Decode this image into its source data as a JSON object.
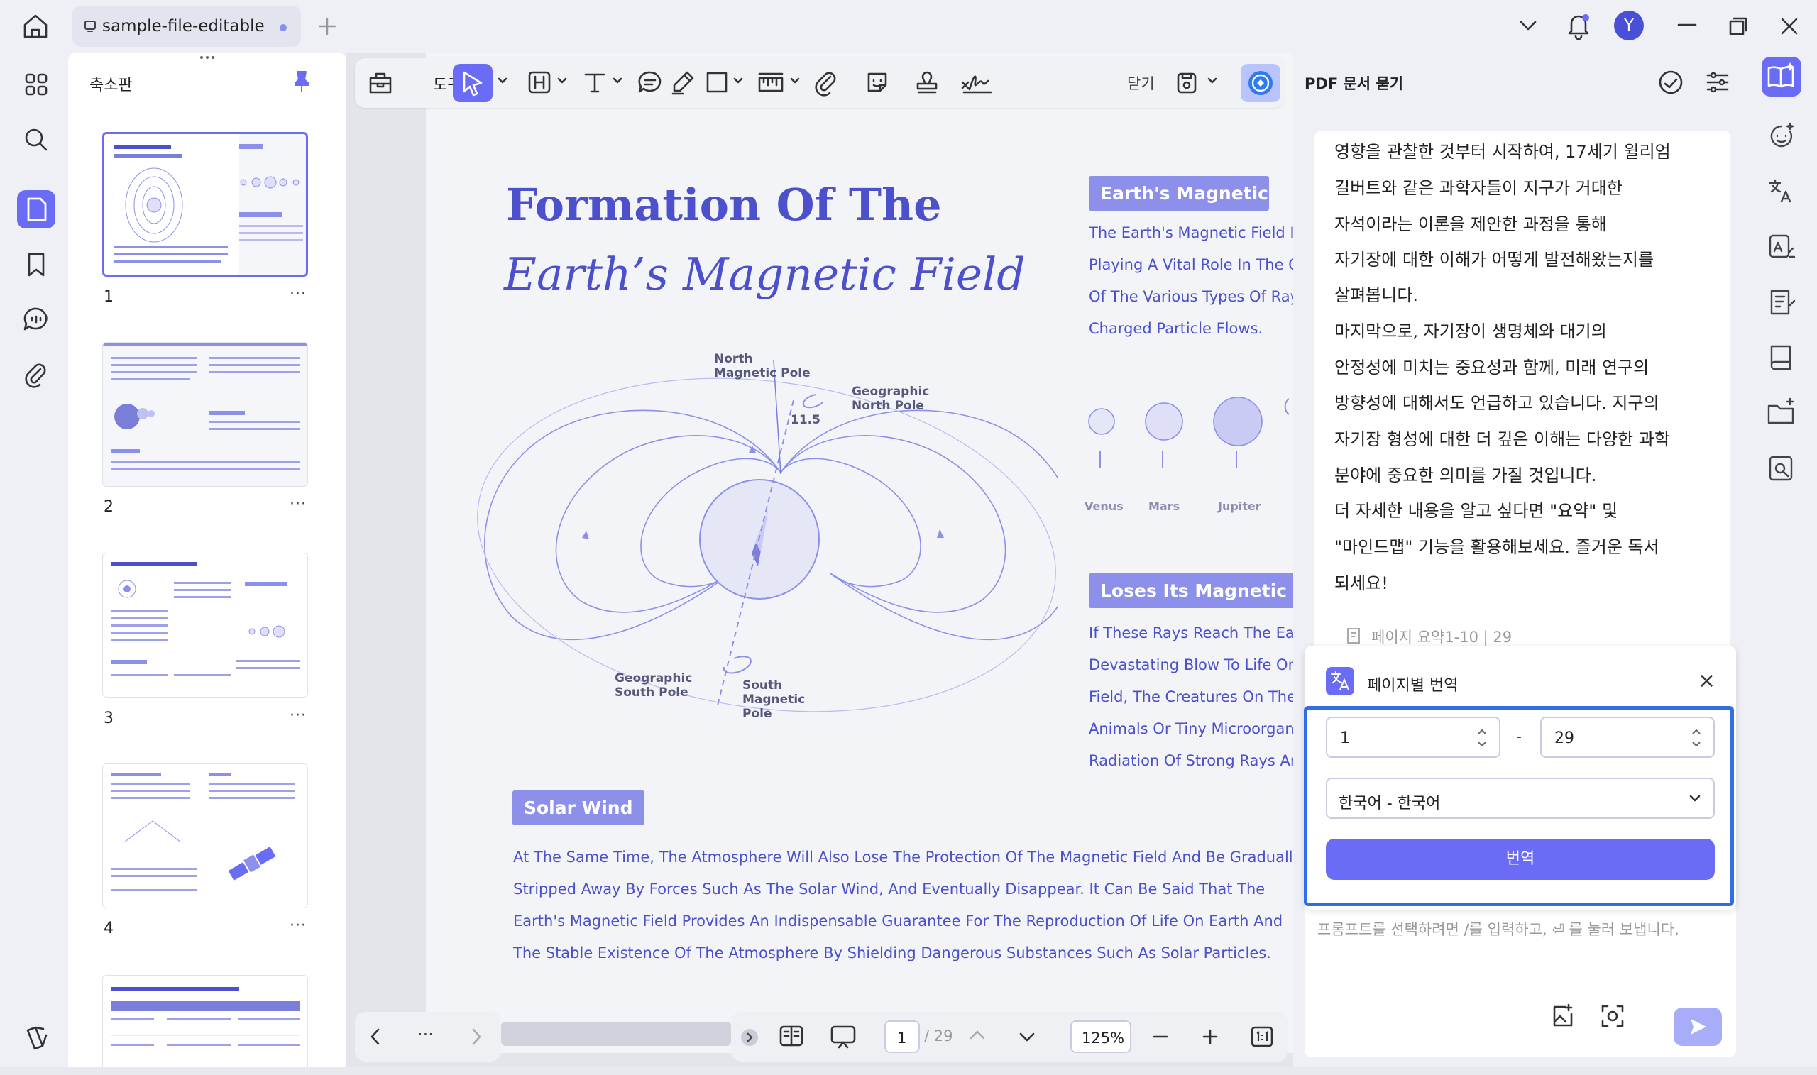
{
  "window": {
    "tab_title": "sample-file-editable",
    "avatar_letter": "Y"
  },
  "sidebar": {
    "title": "축소판",
    "pages": [
      "1",
      "2",
      "3",
      "4"
    ],
    "more": "···"
  },
  "toolbar": {
    "tools_label": "도구",
    "close_label": "닫기"
  },
  "document": {
    "title_line1": "Formation Of The",
    "title_line2": "Earth’s Magnetic Field",
    "earth_tag": "Earth's Magnetic",
    "earth_lines": [
      "The Earth's Magnetic Field Is L",
      "Playing A Vital Role In The Cos",
      "Of The Various Types Of Rays",
      "Charged Particle Flows."
    ],
    "planets": [
      "Venus",
      "Mars",
      "Jupiter"
    ],
    "diagram": {
      "north_magnetic_pole": [
        "North",
        "Magnetic Pole"
      ],
      "geographic_north_pole": [
        "Geographic",
        "North Pole"
      ],
      "angle": "11.5",
      "geographic_south_pole": [
        "Geographic",
        "South Pole"
      ],
      "south_magnetic_pole": [
        "South",
        "Magnetic",
        "Pole"
      ]
    },
    "loses_tag": "Loses Its Magnetic Field",
    "loses_lines": [
      "If These Rays Reach The Earth",
      "Devastating Blow To Life On Ea",
      "Field, The Creatures On The Ea",
      "Animals Or Tiny Microorganism",
      "Radiation Of Strong Rays And"
    ],
    "solar_tag": "Solar Wind",
    "solar_lines": [
      "At The Same Time, The Atmosphere Will Also Lose The Protection Of The Magnetic Field And Be Gradually",
      "Stripped Away By Forces Such As The Solar Wind, And Eventually Disappear. It Can Be Said That The",
      "Earth's Magnetic Field Provides An Indispensable Guarantee For The Reproduction Of Life On Earth And",
      "The Stable Existence Of The Atmosphere By Shielding Dangerous Substances Such As Solar Particles."
    ]
  },
  "chat": {
    "title": "PDF 문서 묻기",
    "lines": [
      "영향을 관찰한 것부터 시작하여, 17세기 윌리엄",
      "길버트와 같은 과학자들이 지구가 거대한",
      "자석이라는 이론을 제안한 과정을 통해",
      "자기장에 대한 이해가 어떻게 발전해왔는지를",
      "살펴봅니다.",
      "마지막으로, 자기장이 생명체와 대기의",
      "안정성에 미치는 중요성과 함께, 미래 연구의",
      "방향성에 대해서도 언급하고 있습니다. 지구의",
      "자기장 형성에 대한 더 깊은 이해는 다양한 과학",
      "분야에 중요한 의미를 가질 것입니다.",
      "더 자세한 내용을 알고 싶다면 \"요약\" 및",
      "\"마인드맵\" 기능을 활용해보세요. 즐거운 독서",
      "되세요!"
    ],
    "summary_link": "페이지 요약1-10 | 29",
    "prompt_placeholder": "프롬프트를 선택하려면 /를 입력하고, ⏎ 를 눌러 보냅니다."
  },
  "translate_popup": {
    "title": "페이지별 번역",
    "from_page": "1",
    "dash": "-",
    "to_page": "29",
    "language": "한국어 - 한국어",
    "button": "번역"
  },
  "bottom_bar": {
    "more": "···",
    "current_page": "1",
    "total_pages": "/ 29",
    "zoom": "125%"
  },
  "colors": {
    "accent": "#6b6cf6",
    "doc_text": "#4d50cc",
    "tag_bg": "#8d90ea",
    "frame": "#2f6ee6"
  }
}
